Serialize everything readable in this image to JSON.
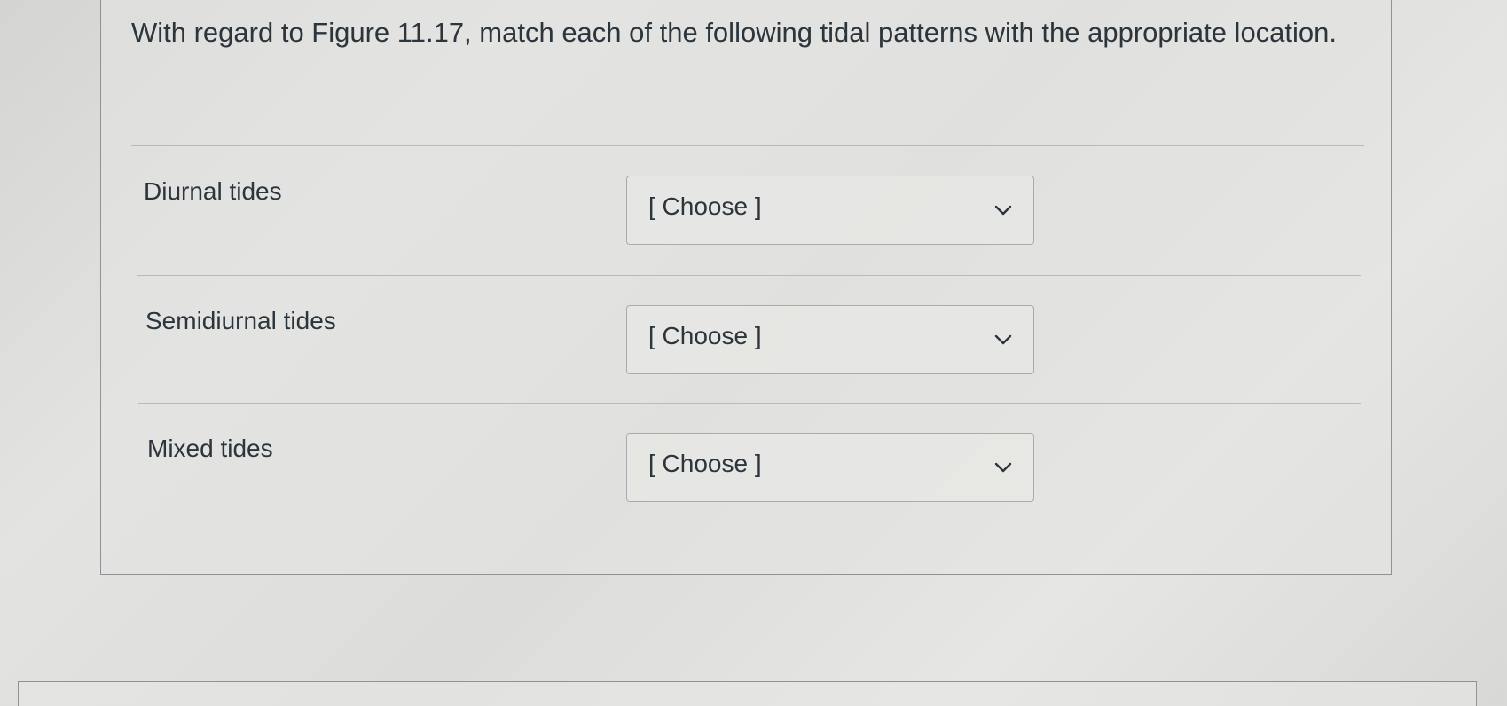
{
  "question": {
    "text": "With regard to Figure 11.17, match each of the following tidal patterns with the appropriate location."
  },
  "rows": [
    {
      "label": "Diurnal tides",
      "selected": "[ Choose ]",
      "icon": "chevron-down-icon"
    },
    {
      "label": "Semidiurnal tides",
      "selected": "[ Choose ]",
      "icon": "chevron-down-icon"
    },
    {
      "label": "Mixed tides",
      "selected": "[ Choose ]",
      "icon": "chevron-down-icon"
    }
  ]
}
